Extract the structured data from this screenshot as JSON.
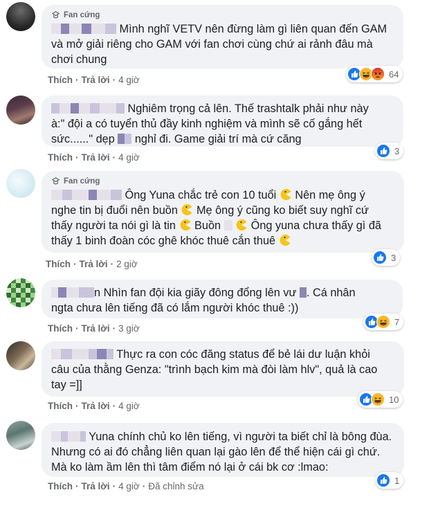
{
  "badge_label": "Fan cứng",
  "action_like": "Thích",
  "action_reply": "Trả lời",
  "comments": [
    {
      "text_lines": [
        "Mình nghĩ VETV nên đừng làm gì liên quan đến GAM",
        "và mở giải riêng cho GAM với fan chơi cùng chứ ai rảnh đâu mà",
        "chơi chung"
      ],
      "time": "4 giờ",
      "reaction_count": "64"
    },
    {
      "text_lines": [
        "Nghiêm trọng cả lên. Thế trashtalk phải như này",
        "à:\" đội a có tuyển thủ đầy kinh nghiệm và mình sẽ cố gắng hết",
        "sức......\" dẹp",
        "nghỉ đi. Game giải trí mà cứ căng"
      ],
      "time": "4 giờ",
      "reaction_count": "3"
    },
    {
      "text_lines": [
        "Ông Yuna chắc trẻ con 10 tuổi",
        "Nên mẹ ông ý",
        "nghe tin bị đuổi nên buồn",
        "Mẹ ông ý cũng ko biết suy nghĩ cứ",
        "thấy người ta nói gì là tin",
        "Buồn",
        "Ông yuna chưa thấy gì đã",
        "thấy 1 binh đoàn cóc ghê khóc thuê cắn thuê"
      ],
      "time": "2 giờ",
      "reaction_count": "3"
    },
    {
      "text_lines": [
        "n Nhìn fan đội kia giãy đông đổng lên vư",
        ". Cá nhân",
        "ngta chưa lên tiếng đã có lắm người khóc thuê :))"
      ],
      "time": "3 giờ",
      "reaction_count": "7"
    },
    {
      "text_lines": [
        "Thực ra con cóc đăng status để bẻ lái dư luận khỏi",
        "câu của thằng Genza: \"trình bạch kim mà đòi làm hlv\", quả là cao",
        "tay =]]"
      ],
      "time": "4 giờ",
      "reaction_count": "10"
    },
    {
      "text_lines": [
        "Yuna chính chủ ko lên tiếng, vì người ta biết chỉ là bông đùa.",
        "Nhưng có ai đó chẳng liên quan lại gào lên để thể hiện cái gì chứ.",
        "Mà ko làm ầm lên thì tâm điểm nó lại ở cái bk cơ :lmao:"
      ],
      "time": "4 giờ",
      "extra_action": "Đã chỉnh sửa",
      "reaction_count": "1"
    }
  ],
  "colors": {
    "like_blue": "#1877f2",
    "haha_yellow": "#f7b928",
    "angry_orange": "#e9710f",
    "bubble_bg": "#f0f2f5"
  }
}
